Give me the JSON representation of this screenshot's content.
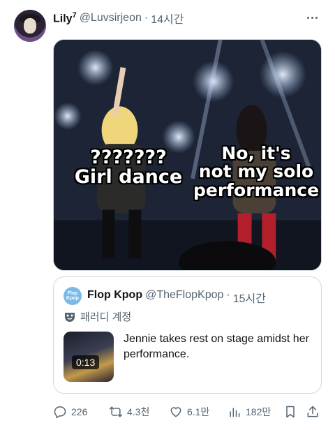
{
  "author": {
    "display_name": "Lily",
    "badge": "7",
    "handle": "@Luvsirjeon",
    "separator": "·",
    "time": "14시간"
  },
  "media": {
    "caption_left": "???????\nGirl dance",
    "caption_right": "No, it's\nnot my solo\nperformance"
  },
  "quoted_tweet": {
    "avatar_text": "Flop Kpop",
    "display_name": "Flop Kpop",
    "handle": "@TheFlopKpop",
    "separator": "·",
    "time": "15시간",
    "parody_label": "패러디 계정",
    "video_duration": "0:13",
    "text": "Jennie takes rest on stage amidst her performance."
  },
  "actions": {
    "replies": "226",
    "retweets": "4.3천",
    "likes": "6.1만",
    "views": "182만"
  },
  "colors": {
    "text_primary": "#0f1419",
    "text_secondary": "#536471",
    "border": "#cfd9de"
  }
}
